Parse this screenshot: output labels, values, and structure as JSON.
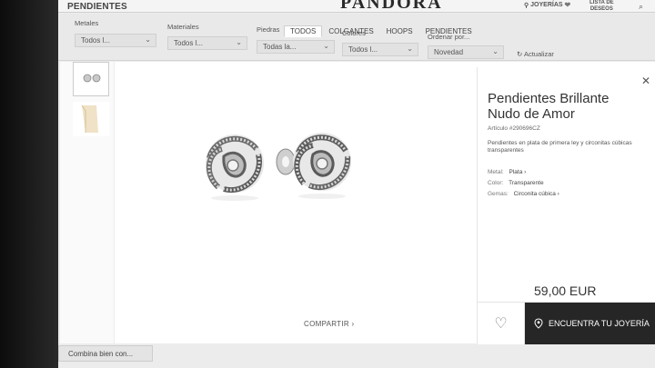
{
  "header": {
    "section_title": "PENDIENTES",
    "logo": "PANDORA",
    "stores_label": "JOYERÍAS",
    "wishlist_line1": "LISTA DE",
    "wishlist_line2": "DESEOS",
    "tabs": [
      "TODOS",
      "COLGANTES",
      "HOOPS",
      "PENDIENTES"
    ],
    "active_tab": "TODOS"
  },
  "filters": {
    "metales": {
      "label": "Metales",
      "value": "Todos l..."
    },
    "materiales": {
      "label": "Materiales",
      "value": "Todos l..."
    },
    "piedras": {
      "label": "Piedras",
      "value": "Todas la..."
    },
    "colores": {
      "label": "Colores",
      "value": "Todos l..."
    },
    "ordenar": {
      "label": "Ordenar por...",
      "value": "Novedad"
    },
    "refresh_label": "Actualizar"
  },
  "product": {
    "title": "Pendientes Brillante Nudo de Amor",
    "article": "Artículo #290696CZ",
    "description": "Pendientes en plata de primera ley y circonitas cúbicas transparentes",
    "attributes": [
      {
        "label": "Metal:",
        "value": "Plata ›"
      },
      {
        "label": "Color:",
        "value": "Transparente"
      },
      {
        "label": "Gemas:",
        "value": "Circonita cúbica ›"
      }
    ],
    "price": "59,00 EUR",
    "store_button": "ENCUENTRA TU JOYERÍA",
    "share_label": "COMPARTIR ›"
  },
  "footer": {
    "combina_label": "Combina bien con..."
  },
  "icons": {
    "close": "close-icon",
    "heart": "heart-icon",
    "location": "location-pin-icon",
    "search": "search-icon",
    "refresh": "refresh-icon"
  }
}
